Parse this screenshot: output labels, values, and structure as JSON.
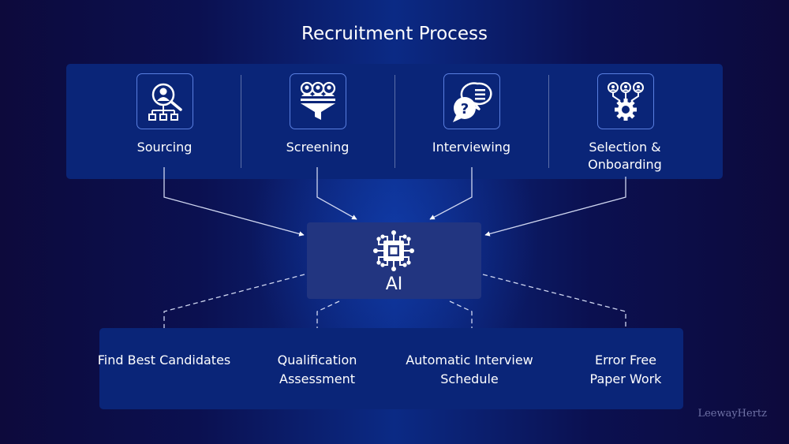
{
  "title": "Recruitment Process",
  "stages": [
    {
      "label": "Sourcing",
      "icon": "candidate-search-icon"
    },
    {
      "label": "Screening",
      "icon": "candidate-filter-icon"
    },
    {
      "label": "Interviewing",
      "icon": "question-chat-icon"
    },
    {
      "label": "Selection & Onboarding",
      "icon": "people-gear-icon"
    }
  ],
  "ai": {
    "label": "AI",
    "icon": "ai-chip-icon"
  },
  "outcomes": [
    {
      "label": "Find Best Candidates"
    },
    {
      "label": "Qualification Assessment"
    },
    {
      "label": "Automatic Interview Schedule"
    },
    {
      "label": "Error Free Paper Work"
    }
  ],
  "brand": "LeewayHertz",
  "colors": {
    "background": "#0d0a3c",
    "panel": "#0a2578",
    "ai_box": "#223580",
    "icon_border": "#5a7fe0",
    "text": "#ffffff"
  }
}
